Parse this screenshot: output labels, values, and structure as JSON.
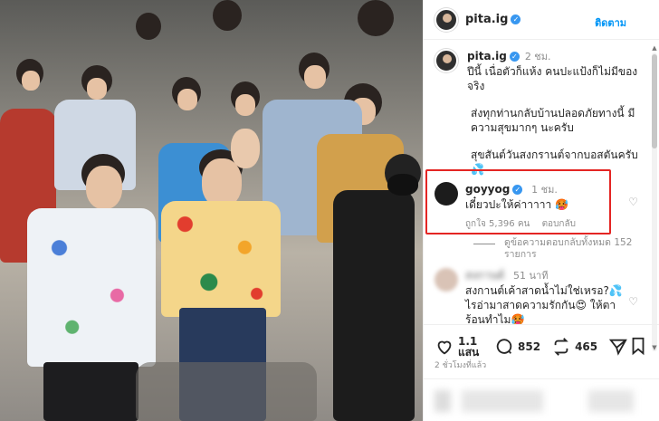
{
  "post": {
    "username": "pita.ig",
    "follow_label": "ติดตาม",
    "caption_time": "2 ชม.",
    "caption_line1": "ปีนี้ เนื่อตัวก็แห้ง คนปะแป้งก็ไม่มีของจริง",
    "caption_line2": "ส่งทุกท่านกลับบ้านปลอดภัยทางนี้ มีความสุขมากๆ นะครับ",
    "caption_line3": "สุขสันต์วันสงกรานต์จากบอสตันครับ 💦",
    "verified": true
  },
  "comments": [
    {
      "username": "goyyog",
      "time": "1 ชม.",
      "text": "เดี๋ยวปะให้ค่าาาาา 🥵",
      "likes": "ถูกใจ 5,396 คน",
      "reply_label": "ตอบกลับ",
      "view_replies": "ดูข้อความตอบกลับทั้งหมด 152 รายการ",
      "verified": true
    },
    {
      "username": "สงกานต์",
      "time": "51 นาที",
      "text": "สงกานต์เค้าสาดน้ำไม่ใช่เหรอ?💦 ไรอ่ามาสาดความรักกัน😍 ให้ตาร้อนทำไม🥵"
    }
  ],
  "actions": {
    "likes_count": "1.1 แสน",
    "comments_count": "852",
    "reposts_count": "465",
    "posted_ago": "2 ชั่วโมงที่แล้ว"
  },
  "icons": [
    "verified-badge-icon",
    "heart-icon",
    "comment-icon",
    "repost-icon",
    "share-icon",
    "bookmark-icon"
  ],
  "colors": {
    "accent": "#0095f6",
    "highlight_border": "#e42523",
    "verified": "#3897f0"
  }
}
